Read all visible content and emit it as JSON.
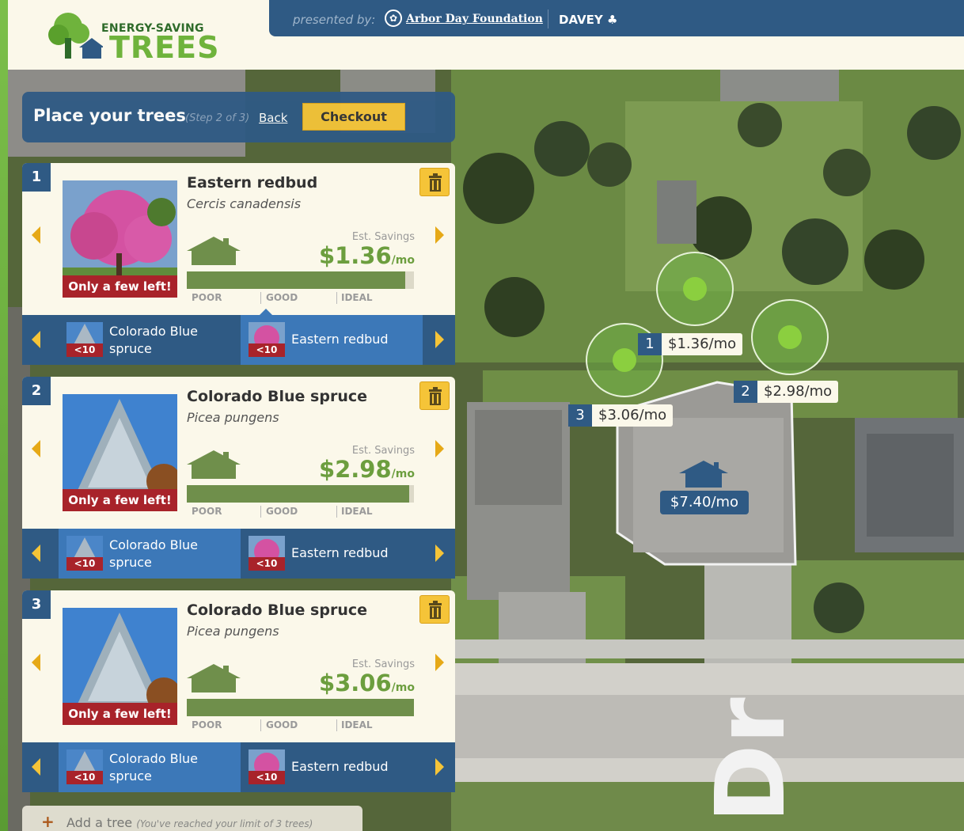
{
  "header": {
    "logo_small": "ENERGY-SAVING",
    "logo_big": "TREES",
    "presented_by": "presented by:",
    "sponsor_1": "Arbor Day Foundation",
    "sponsor_2": "DAVEY"
  },
  "step": {
    "title": "Place your trees",
    "subtitle": "(Step 2 of 3)",
    "back": "Back",
    "checkout": "Checkout"
  },
  "cards": [
    {
      "number": "1",
      "name": "Eastern redbud",
      "latin": "Cercis canadensis",
      "badge": "Only a few left!",
      "est_label": "Est. Savings",
      "savings": "$1.36",
      "per": "/mo",
      "bar_fill_fraction": 0.96,
      "scale": [
        "POOR",
        "GOOD",
        "IDEAL"
      ],
      "options": [
        {
          "label": "Colorado Blue spruce",
          "count": "<10",
          "selected": false
        },
        {
          "label": "Eastern redbud",
          "count": "<10",
          "selected": true
        }
      ]
    },
    {
      "number": "2",
      "name": "Colorado Blue spruce",
      "latin": "Picea pungens",
      "badge": "Only a few left!",
      "est_label": "Est. Savings",
      "savings": "$2.98",
      "per": "/mo",
      "bar_fill_fraction": 0.98,
      "scale": [
        "POOR",
        "GOOD",
        "IDEAL"
      ],
      "options": [
        {
          "label": "Colorado Blue spruce",
          "count": "<10",
          "selected": true
        },
        {
          "label": "Eastern redbud",
          "count": "<10",
          "selected": false
        }
      ]
    },
    {
      "number": "3",
      "name": "Colorado Blue spruce",
      "latin": "Picea pungens",
      "badge": "Only a few left!",
      "est_label": "Est. Savings",
      "savings": "$3.06",
      "per": "/mo",
      "bar_fill_fraction": 1.0,
      "scale": [
        "POOR",
        "GOOD",
        "IDEAL"
      ],
      "options": [
        {
          "label": "Colorado Blue spruce",
          "count": "<10",
          "selected": true
        },
        {
          "label": "Eastern redbud",
          "count": "<10",
          "selected": false
        }
      ]
    }
  ],
  "add_tree": {
    "label": "Add a tree",
    "note": "(You've reached your limit of 3 trees)"
  },
  "map": {
    "tree_labels": [
      {
        "number": "1",
        "value": "$1.36/mo"
      },
      {
        "number": "2",
        "value": "$2.98/mo"
      },
      {
        "number": "3",
        "value": "$3.06/mo"
      }
    ],
    "house_value": "$7.40/mo",
    "street_text": "Dr"
  },
  "colors": {
    "brand_blue": "#2f5a84",
    "accent_yellow": "#f5c438",
    "savings_green": "#6c9e3e",
    "badge_red": "#a8232a",
    "card_bg": "#fbf8ea"
  },
  "icons": [
    "tree-logo-icon",
    "arbor-day-icon",
    "davey-tree-icon",
    "trash-icon",
    "house-icon",
    "arrow-left-icon",
    "arrow-right-icon",
    "plus-icon"
  ]
}
